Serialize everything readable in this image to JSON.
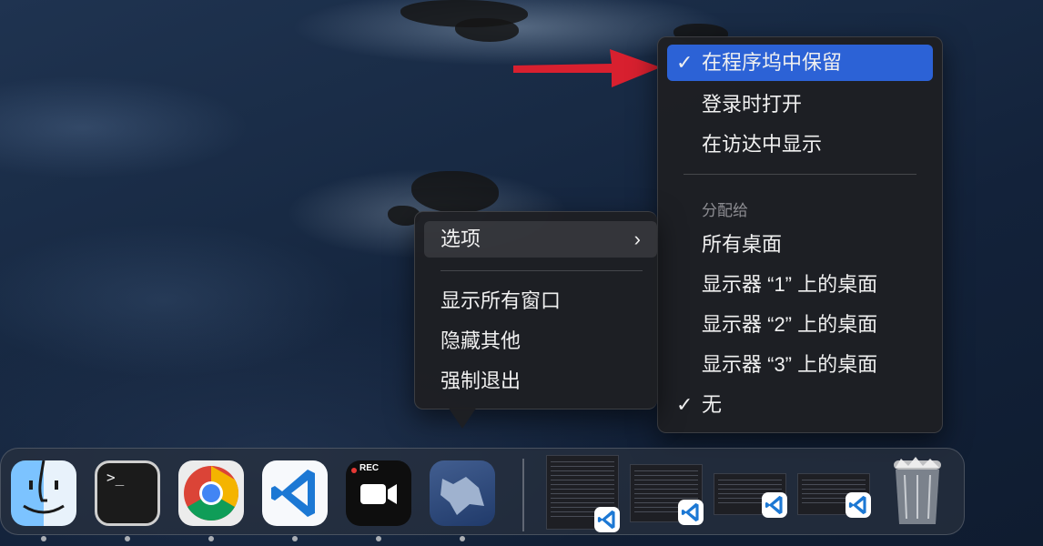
{
  "options_submenu": {
    "keep_in_dock": "在程序坞中保留",
    "open_at_login": "登录时打开",
    "show_in_finder": "在访达中显示",
    "assign_to_header": "分配给",
    "all_desktops": "所有桌面",
    "display1_desktop": "显示器 “1” 上的桌面",
    "display2_desktop": "显示器 “2” 上的桌面",
    "display3_desktop": "显示器 “3” 上的桌面",
    "none": "无",
    "check_glyph": "✓"
  },
  "dock_menu": {
    "options": "选项",
    "options_chevron": "›",
    "show_all_windows": "显示所有窗口",
    "hide_others": "隐藏其他",
    "force_quit": "强制退出"
  },
  "dock": {
    "apps": [
      "finder-icon",
      "terminal-icon",
      "chrome-icon",
      "vscode-icon",
      "screen-recorder-icon",
      "wolf-app-icon"
    ],
    "terminal_prompt": ">_",
    "rec_label": "REC",
    "minimized_windows": 4,
    "trash": "trash-icon"
  },
  "colors": {
    "highlight": "#2c62d6",
    "arrow": "#d8202f",
    "menu_bg": "#1e1f23"
  }
}
